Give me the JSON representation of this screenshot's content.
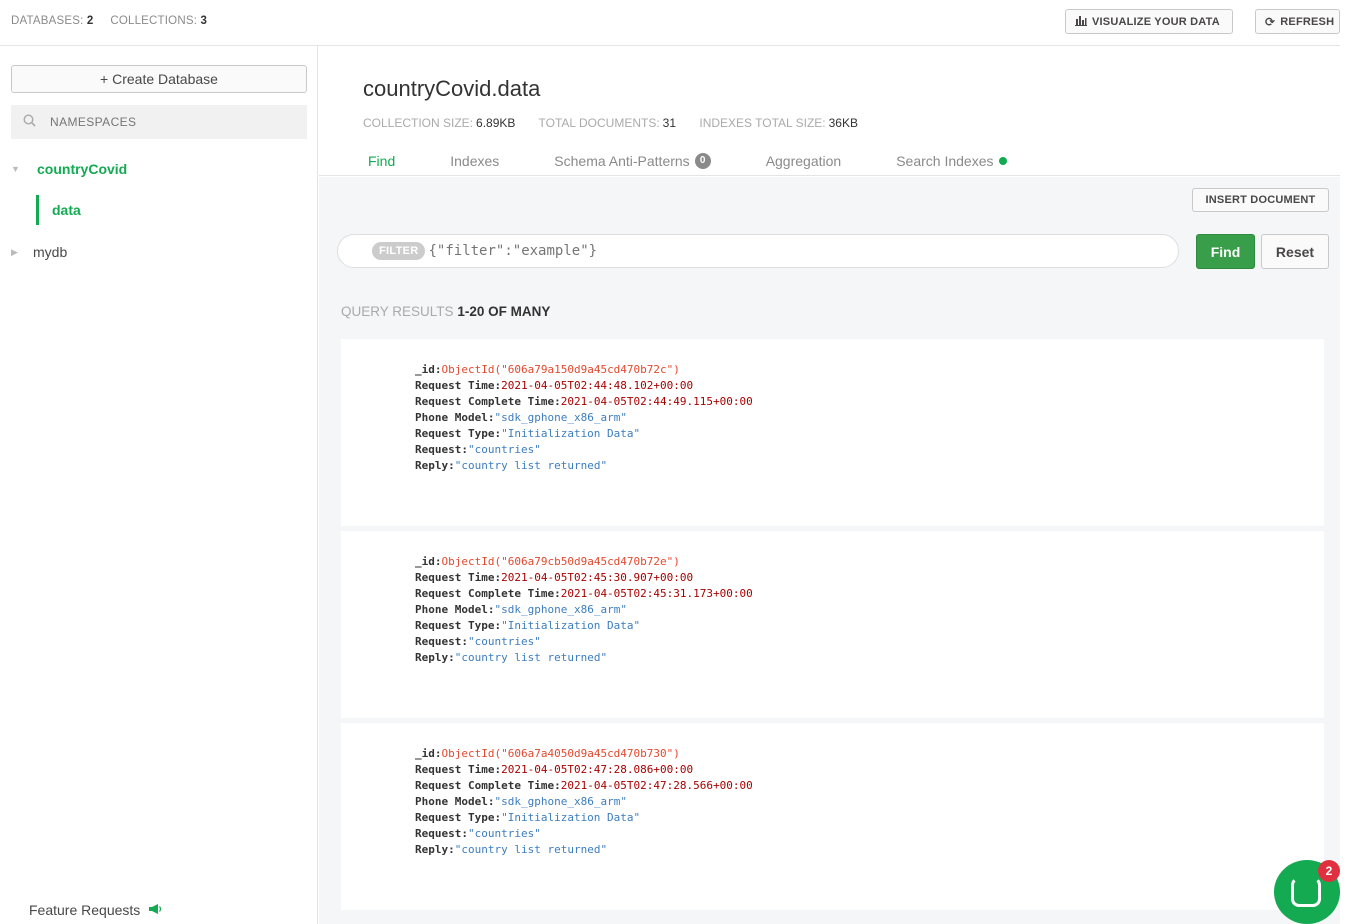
{
  "topbar": {
    "databases_label": "DATABASES:",
    "databases_count": "2",
    "collections_label": "COLLECTIONS:",
    "collections_count": "3",
    "visualize_label": "VISUALIZE YOUR DATA",
    "visualize_icon": "bar-chart-icon",
    "refresh_label": "REFRESH",
    "refresh_icon": "refresh-icon"
  },
  "sidebar": {
    "create_db_label": "+ Create Database",
    "namespaces_placeholder": "NAMESPACES",
    "databases": [
      {
        "name": "countryCovid",
        "expanded": true,
        "collections": [
          {
            "name": "data",
            "selected": true
          }
        ]
      },
      {
        "name": "mydb",
        "expanded": false,
        "collections": []
      }
    ],
    "feature_requests_label": "Feature Requests"
  },
  "collection": {
    "title": "countryCovid.data",
    "size_label": "COLLECTION SIZE:",
    "size_value": "6.89KB",
    "docs_label": "TOTAL DOCUMENTS:",
    "docs_value": "31",
    "indexes_label": "INDEXES TOTAL SIZE:",
    "indexes_value": "36KB",
    "tabs": [
      {
        "label": "Find",
        "active": true
      },
      {
        "label": "Indexes"
      },
      {
        "label": "Schema Anti-Patterns",
        "badge": "0"
      },
      {
        "label": "Aggregation"
      },
      {
        "label": "Search Indexes",
        "dot": true
      }
    ]
  },
  "query": {
    "insert_label": "INSERT DOCUMENT",
    "filter_pill": "FILTER",
    "filter_placeholder": "{\"filter\":\"example\"}",
    "find_label": "Find",
    "reset_label": "Reset",
    "results_label": "QUERY RESULTS",
    "results_range": "1-20 OF MANY"
  },
  "documents": [
    {
      "id_key": "_id:",
      "id_value": "ObjectId(\"606a79a150d9a45cd470b72c\")",
      "rt_key": "Request Time:",
      "rt_value": "2021-04-05T02:44:48.102+00:00",
      "rct_key": "Request Complete Time:",
      "rct_value": "2021-04-05T02:44:49.115+00:00",
      "pm_key": "Phone Model:",
      "pm_value": "\"sdk_gphone_x86_arm\"",
      "rty_key": "Request Type:",
      "rty_value": "\"Initialization Data\"",
      "req_key": "Request:",
      "req_value": "\"countries\"",
      "rep_key": "Reply:",
      "rep_value": "\"country list returned\""
    },
    {
      "id_key": "_id:",
      "id_value": "ObjectId(\"606a79cb50d9a45cd470b72e\")",
      "rt_key": "Request Time:",
      "rt_value": "2021-04-05T02:45:30.907+00:00",
      "rct_key": "Request Complete Time:",
      "rct_value": "2021-04-05T02:45:31.173+00:00",
      "pm_key": "Phone Model:",
      "pm_value": "\"sdk_gphone_x86_arm\"",
      "rty_key": "Request Type:",
      "rty_value": "\"Initialization Data\"",
      "req_key": "Request:",
      "req_value": "\"countries\"",
      "rep_key": "Reply:",
      "rep_value": "\"country list returned\""
    },
    {
      "id_key": "_id:",
      "id_value": "ObjectId(\"606a7a4050d9a45cd470b730\")",
      "rt_key": "Request Time:",
      "rt_value": "2021-04-05T02:47:28.086+00:00",
      "rct_key": "Request Complete Time:",
      "rct_value": "2021-04-05T02:47:28.566+00:00",
      "pm_key": "Phone Model:",
      "pm_value": "\"sdk_gphone_x86_arm\"",
      "rty_key": "Request Type:",
      "rty_value": "\"Initialization Data\"",
      "req_key": "Request:",
      "req_value": "\"countries\"",
      "rep_key": "Reply:",
      "rep_value": "\"country list returned\""
    }
  ],
  "chat": {
    "notification_count": "2",
    "icon": "chat-icon"
  },
  "colors": {
    "accent": "#13aa52",
    "find_button": "#399e4a",
    "oid": "#e2492f",
    "date": "#a80000",
    "string": "#3d7dbe"
  }
}
